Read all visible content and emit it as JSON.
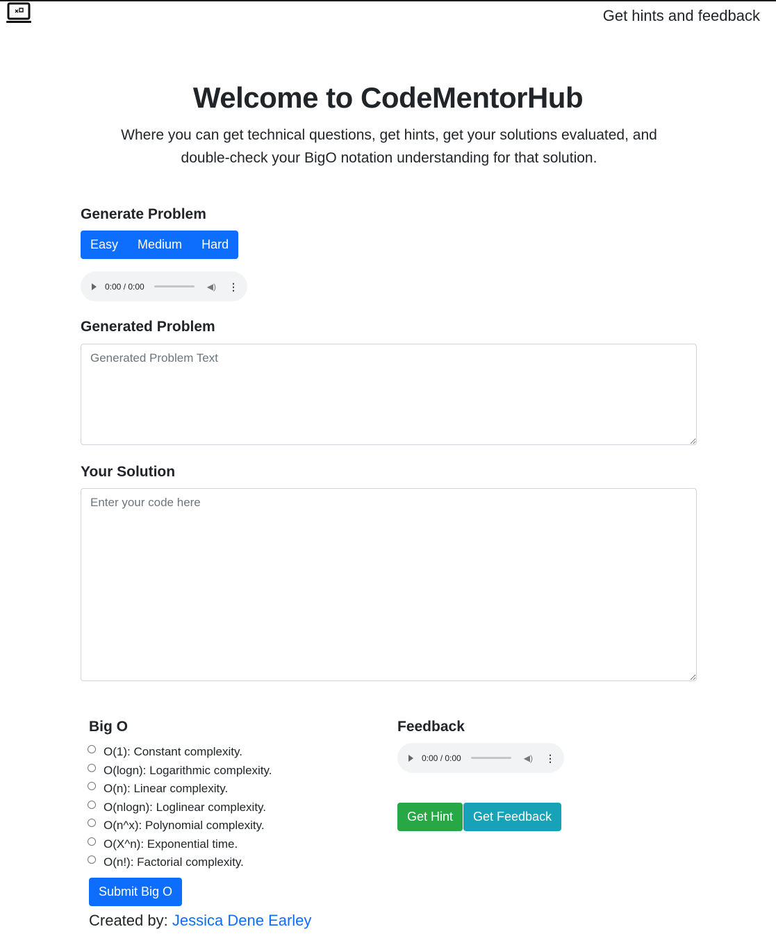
{
  "nav": {
    "logo_icon": "laptop-code-icon",
    "link": "Get hints and feedback"
  },
  "hero": {
    "title": "Welcome to CodeMentorHub",
    "lead": "Where you can get technical questions, get hints, get your solutions evaluated, and double-check your BigO notation understanding for that solution."
  },
  "generate": {
    "heading": "Generate Problem",
    "buttons": [
      "Easy",
      "Medium",
      "Hard"
    ]
  },
  "audio_problem": {
    "time": "0:00 / 0:00",
    "play_icon": "play-icon",
    "volume_icon": "volume-icon",
    "menu_icon": "more-vert-icon"
  },
  "generated": {
    "heading": "Generated Problem",
    "placeholder": "Generated Problem Text"
  },
  "solution": {
    "heading": "Your Solution",
    "placeholder": "Enter your code here"
  },
  "bigo": {
    "heading": "Big O",
    "options": [
      "O(1): Constant complexity.",
      "O(logn): Logarithmic complexity.",
      "O(n): Linear complexity.",
      "O(nlogn): Loglinear complexity.",
      "O(n^x): Polynomial complexity.",
      "O(X^n): Exponential time.",
      "O(n!): Factorial complexity."
    ],
    "submit": "Submit Big O"
  },
  "feedback": {
    "heading": "Feedback",
    "audio_time": "0:00 / 0:00",
    "hint_button": "Get Hint",
    "feedback_button": "Get Feedback"
  },
  "credit": {
    "prefix": "Created by:",
    "name": "Jessica Dene Earley"
  },
  "colors": {
    "primary": "#0d6efd",
    "success": "#28a745",
    "info": "#17a2b8",
    "text": "#212529"
  }
}
